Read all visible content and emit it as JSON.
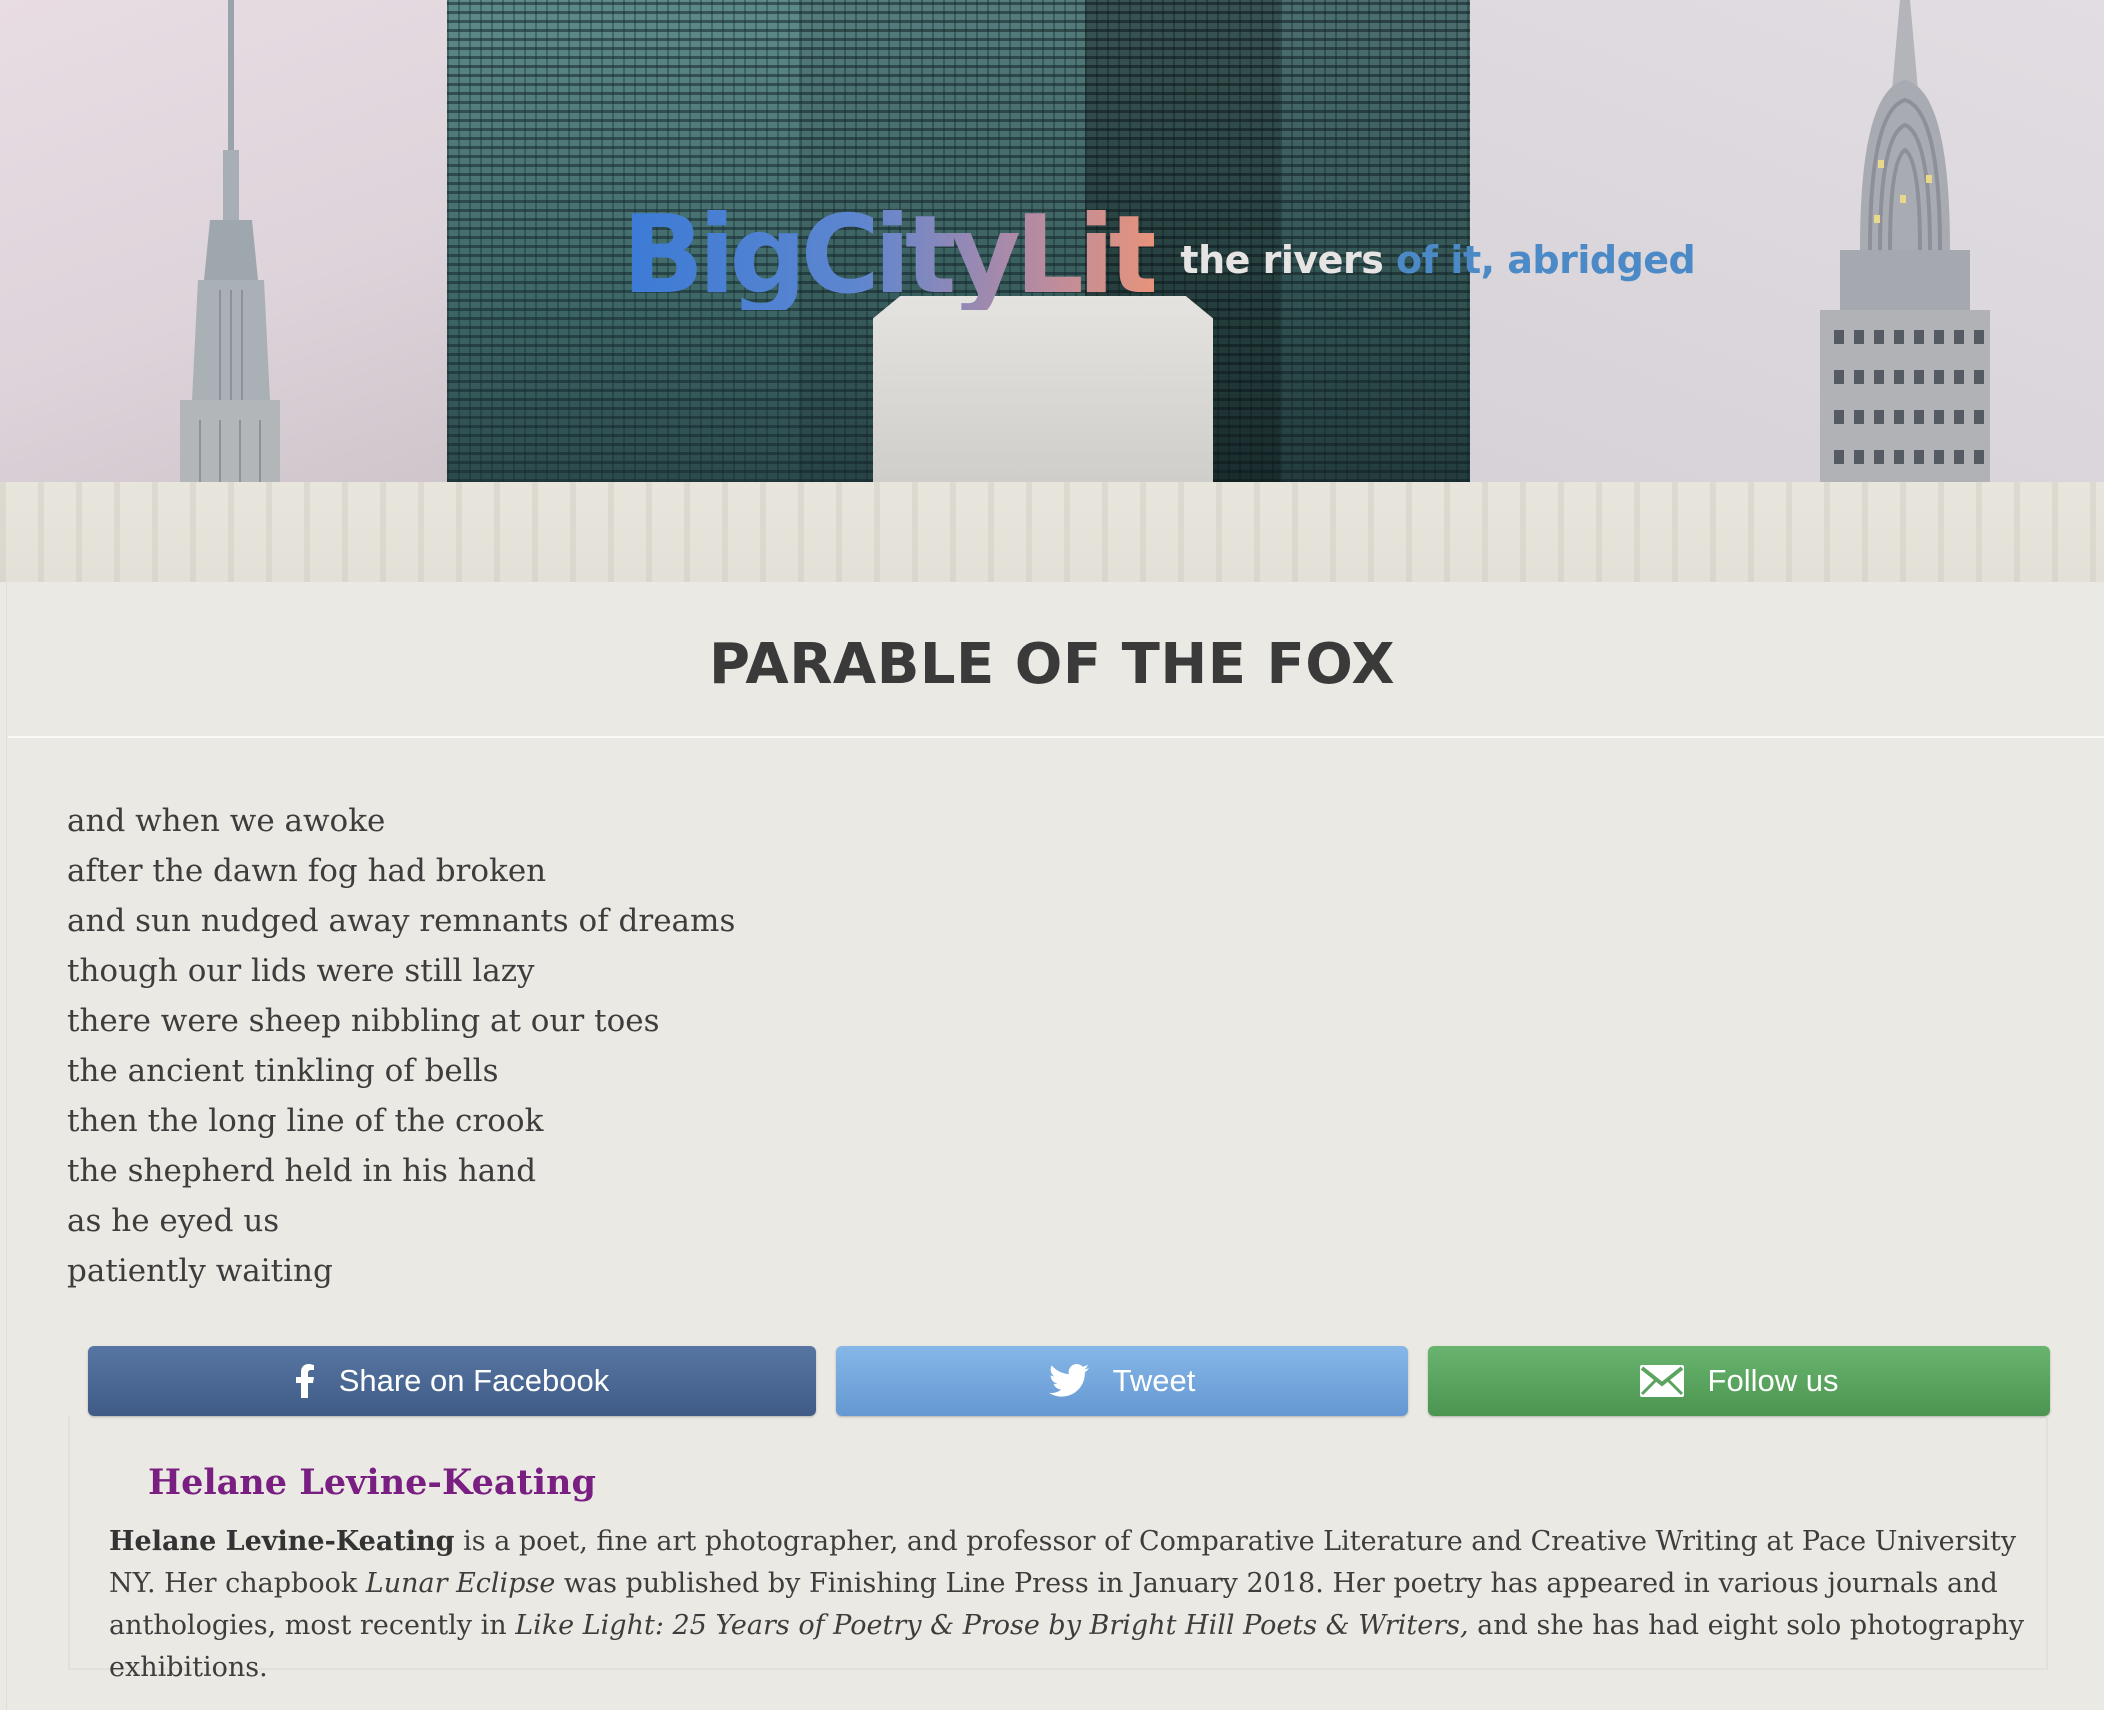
{
  "header": {
    "logo_text": "BigCityLit",
    "tagline_part1": "the rivers ",
    "tagline_part2": "of it, abridged"
  },
  "poem": {
    "title": "PARABLE OF THE FOX",
    "lines": [
      "and when we awoke",
      "after the dawn fog had broken",
      "and sun nudged away remnants of dreams",
      "though our lids were still lazy",
      "there were sheep nibbling at our toes",
      "the ancient tinkling of bells",
      "then the long line of the crook",
      "the shepherd held in his hand",
      "as he eyed us",
      "patiently waiting"
    ]
  },
  "share": {
    "facebook_label": "Share on Facebook",
    "facebook_icon": "facebook-icon",
    "facebook_color": "#4a6792",
    "twitter_label": "Tweet",
    "twitter_icon": "twitter-bird-icon",
    "twitter_color": "#75a7dd",
    "follow_label": "Follow us",
    "follow_icon": "envelope-icon",
    "follow_color": "#5aa45f"
  },
  "author": {
    "name": "Helane Levine-Keating",
    "name_color": "#7a1f82",
    "bio_name": "Helane Levine-Keating",
    "bio_text1": " is a poet, fine art photographer, and professor of Comparative Literature and Creative Writing at Pace University NY. Her chapbook ",
    "bio_book": "Lunar Eclipse",
    "bio_text2": " was published by Finishing Line Press in January 2018. Her poetry has appeared in various journals and anthologies, most recently in ",
    "bio_anthology": "Like Light: 25 Years of Poetry & Prose by Bright Hill Poets & Writers,",
    "bio_text3": " and she has had eight solo photography exhibitions."
  }
}
